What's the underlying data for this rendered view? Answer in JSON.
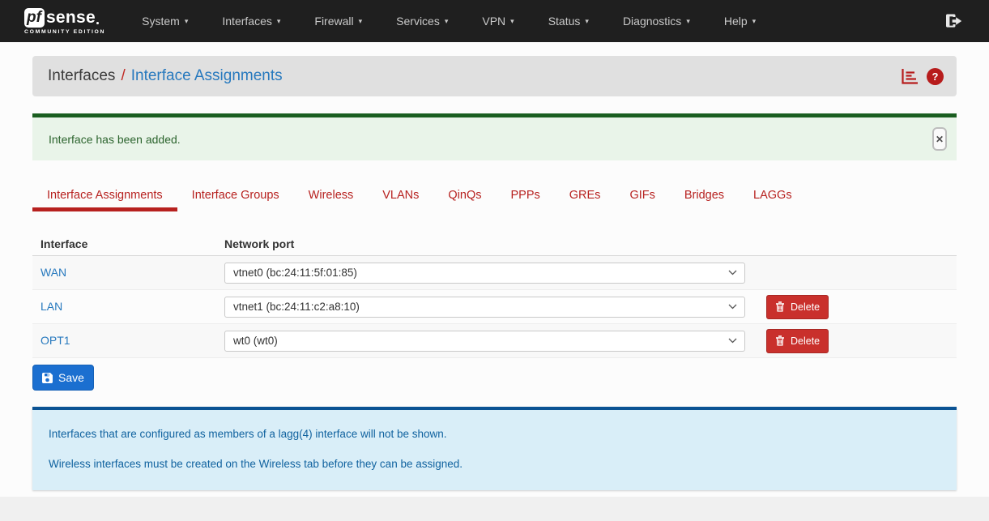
{
  "navbar": {
    "brand": {
      "pf": "pf",
      "sense": "sense",
      "edition": "COMMUNITY EDITION"
    },
    "items": [
      {
        "label": "System"
      },
      {
        "label": "Interfaces"
      },
      {
        "label": "Firewall"
      },
      {
        "label": "Services"
      },
      {
        "label": "VPN"
      },
      {
        "label": "Status"
      },
      {
        "label": "Diagnostics"
      },
      {
        "label": "Help"
      }
    ]
  },
  "breadcrumb": {
    "section": "Interfaces",
    "separator": "/",
    "page": "Interface Assignments"
  },
  "alert": {
    "message": "Interface has been added."
  },
  "tabs": [
    {
      "label": "Interface Assignments",
      "active": true
    },
    {
      "label": "Interface Groups",
      "active": false
    },
    {
      "label": "Wireless",
      "active": false
    },
    {
      "label": "VLANs",
      "active": false
    },
    {
      "label": "QinQs",
      "active": false
    },
    {
      "label": "PPPs",
      "active": false
    },
    {
      "label": "GREs",
      "active": false
    },
    {
      "label": "GIFs",
      "active": false
    },
    {
      "label": "Bridges",
      "active": false
    },
    {
      "label": "LAGGs",
      "active": false
    }
  ],
  "table": {
    "headers": [
      "Interface",
      "Network port"
    ],
    "rows": [
      {
        "interface": "WAN",
        "port": "vtnet0 (bc:24:11:5f:01:85)",
        "deletable": false
      },
      {
        "interface": "LAN",
        "port": "vtnet1 (bc:24:11:c2:a8:10)",
        "deletable": true
      },
      {
        "interface": "OPT1",
        "port": "wt0 (wt0)",
        "deletable": true
      }
    ],
    "delete_label": "Delete"
  },
  "actions": {
    "save_label": "Save"
  },
  "notes": [
    "Interfaces that are configured as members of a lagg(4) interface will not be shown.",
    "Wireless interfaces must be created on the Wireless tab before they can be assigned."
  ],
  "icons": {
    "caret_glyph": "▾",
    "help_glyph": "?",
    "close_glyph": "✕"
  },
  "colors": {
    "navbar_bg": "#1f1f1f",
    "breadcrumb_bg": "#e0e0e0",
    "accent_red": "#b7211f",
    "link_blue": "#2779be",
    "save_blue": "#1b6fd0",
    "delete_red": "#c9302c",
    "alert_bg": "#e9f4e9",
    "alert_border": "#1a5e20",
    "note_bg": "#d9eef8",
    "note_border": "#0b5394"
  }
}
